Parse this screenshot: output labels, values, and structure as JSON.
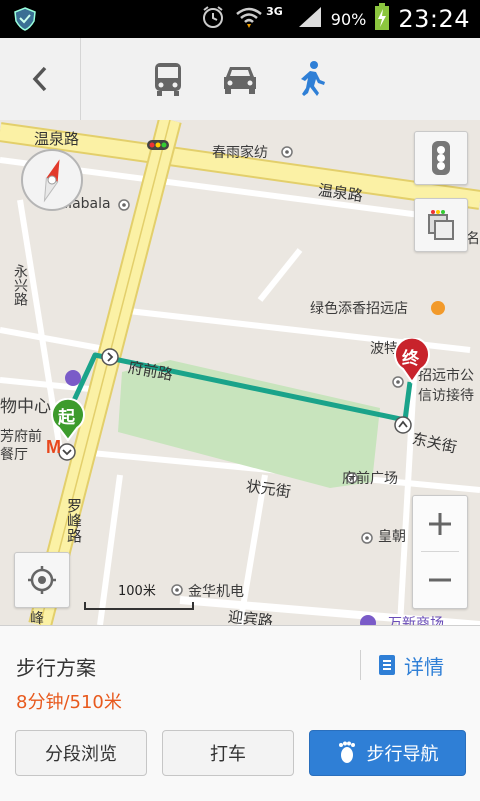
{
  "status_bar": {
    "network": "3G",
    "battery_percent": "90%",
    "time": "23:24"
  },
  "header": {
    "modes": [
      {
        "name": "bus",
        "active": false
      },
      {
        "name": "car",
        "active": false
      },
      {
        "name": "walk",
        "active": true
      }
    ],
    "active_color": "#2f7fd6"
  },
  "map": {
    "labels": {
      "wenquan_road_1": "温泉路",
      "wenquan_road_2": "温泉路",
      "chunyu_jiafang": "春雨家纺",
      "balabala": "Balabala",
      "yongxing_road": "永兴路",
      "lvse_tianxiang": "绿色添香招远店",
      "bote": "波特",
      "zhaoyuan_shi": "招远市公",
      "xinfang": "信访接待",
      "fuqian_road": "府前路",
      "dongguan_street": "东关街",
      "wuzhongxin": "物中心",
      "fangfuqian": "芳府前",
      "canting": "餐厅",
      "zhuangyuan_street": "状元街",
      "fuqian_guangchang": "府前广场",
      "luofeng_road": "罗峰路",
      "huangchao": "皇朝",
      "jinhua_jidian": "金华机电",
      "yingbin_road": "迎宾路",
      "wanda": "万新商场",
      "ge": "名",
      "feng": "峰"
    },
    "markers": {
      "start": "起",
      "end": "终"
    },
    "scale_text": "100米",
    "route_color": "#1aa38a",
    "start_color": "#3d9b2c",
    "end_color": "#c8232c"
  },
  "panel": {
    "title": "步行方案",
    "meta": "8分钟/510米",
    "detail_label": "详情",
    "buttons": {
      "segment": "分段浏览",
      "taxi": "打车",
      "navigate": "步行导航"
    }
  }
}
